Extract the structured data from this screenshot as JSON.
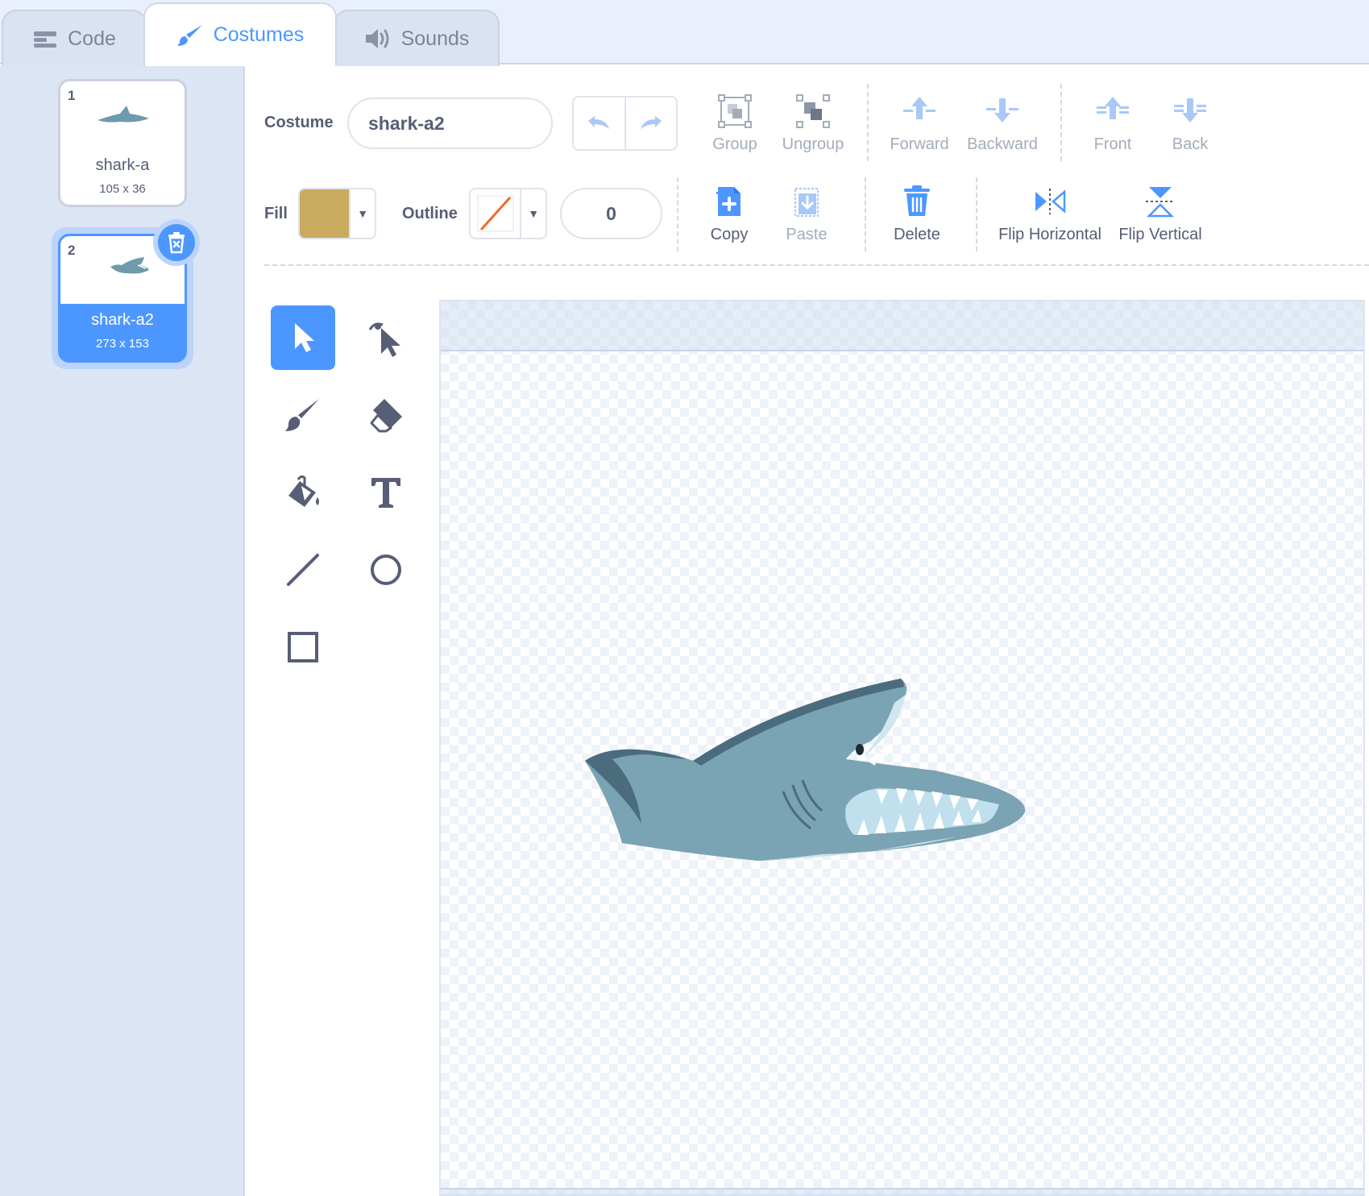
{
  "tabs": [
    {
      "label": "Code",
      "icon": "code-icon"
    },
    {
      "label": "Costumes",
      "icon": "paintbrush-icon",
      "active": true
    },
    {
      "label": "Sounds",
      "icon": "speaker-icon"
    }
  ],
  "costumes": [
    {
      "number": "1",
      "name": "shark-a",
      "size": "105 x 36"
    },
    {
      "number": "2",
      "name": "shark-a2",
      "size": "273 x 153",
      "selected": true
    }
  ],
  "editor": {
    "costume_label": "Costume",
    "costume_name": "shark-a2",
    "fill_label": "Fill",
    "fill_color": "#c8ab5f",
    "outline_label": "Outline",
    "outline_width": "0",
    "group_label": "Group",
    "ungroup_label": "Ungroup",
    "forward_label": "Forward",
    "backward_label": "Backward",
    "front_label": "Front",
    "back_label": "Back",
    "copy_label": "Copy",
    "paste_label": "Paste",
    "delete_label": "Delete",
    "flip_horizontal_label": "Flip Horizontal",
    "flip_vertical_label": "Flip Vertical"
  },
  "tools": [
    "select",
    "reshape",
    "brush",
    "eraser",
    "fill",
    "text",
    "line",
    "circle",
    "rectangle"
  ],
  "colors": {
    "accent": "#4c97ff",
    "text": "#575e75",
    "dim": "#a3acba",
    "shark": "#7aa3b3"
  }
}
